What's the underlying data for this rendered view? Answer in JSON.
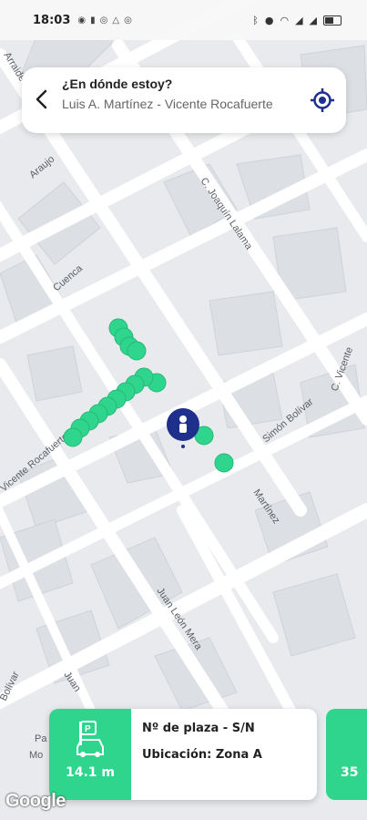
{
  "status_bar": {
    "time": "18:03",
    "left_icons": [
      "whatsapp-icon",
      "battery-saver-icon",
      "instagram-icon",
      "drive-icon",
      "instagram-icon"
    ],
    "right_icons": [
      "bluetooth-icon",
      "location-icon",
      "wifi-icon",
      "signal-icon",
      "signal-icon",
      "battery-icon"
    ]
  },
  "search": {
    "title": "¿En dónde estoy?",
    "location": "Luis A. Martínez - Vicente Rocafuerte"
  },
  "map": {
    "street_labels": [
      "Arraide",
      "Araujo",
      "Cuenca",
      "C. Joaquín Lalama",
      "Vicente Rocafuerte",
      "Simón Bolívar",
      "C. Vicente",
      "Martínez",
      "Juan León Mera",
      "Juan",
      "Bolívar",
      "Pa",
      "Mo"
    ],
    "accent_color": "#2fd58c",
    "user_marker_color": "#1e2f8c"
  },
  "parking_card": {
    "distance": "14.1 m",
    "place_label": "Nº de plaza - S/N",
    "location_label": "Ubicación: Zona A"
  },
  "next_card": {
    "distance": "35"
  },
  "attribution": "Google"
}
